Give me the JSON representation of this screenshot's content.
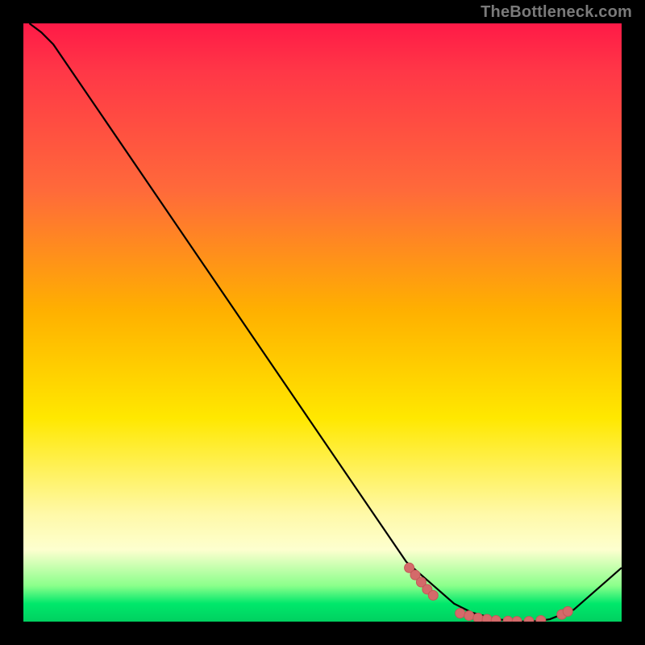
{
  "watermark": "TheBottleneck.com",
  "chart_data": {
    "type": "line",
    "title": "",
    "xlabel": "",
    "ylabel": "",
    "xlim": [
      0,
      100
    ],
    "ylim": [
      0,
      100
    ],
    "grid": false,
    "legend": false,
    "series": [
      {
        "name": "curve",
        "x": [
          1,
          3,
          5,
          64,
          72,
          75,
          78,
          80,
          82,
          84,
          86,
          88,
          92,
          100
        ],
        "y": [
          100,
          98.5,
          96.5,
          10,
          3,
          1.5,
          0.7,
          0.3,
          0.1,
          0,
          0.1,
          0.4,
          2,
          9
        ]
      }
    ],
    "markers": [
      {
        "x": 64.5,
        "y": 9.0
      },
      {
        "x": 65.5,
        "y": 7.8
      },
      {
        "x": 66.5,
        "y": 6.6
      },
      {
        "x": 67.5,
        "y": 5.4
      },
      {
        "x": 68.5,
        "y": 4.4
      },
      {
        "x": 73.0,
        "y": 1.4
      },
      {
        "x": 74.5,
        "y": 1.0
      },
      {
        "x": 76.0,
        "y": 0.6
      },
      {
        "x": 77.5,
        "y": 0.4
      },
      {
        "x": 79.0,
        "y": 0.2
      },
      {
        "x": 81.0,
        "y": 0.1
      },
      {
        "x": 82.5,
        "y": 0.05
      },
      {
        "x": 84.5,
        "y": 0.05
      },
      {
        "x": 86.5,
        "y": 0.2
      },
      {
        "x": 90.0,
        "y": 1.2
      },
      {
        "x": 91.0,
        "y": 1.7
      }
    ],
    "colors": {
      "line": "#000000",
      "marker_fill": "#d46a6a",
      "marker_stroke": "#c45858",
      "gradient_top": "#ff1a47",
      "gradient_bottom": "#00d060"
    }
  }
}
